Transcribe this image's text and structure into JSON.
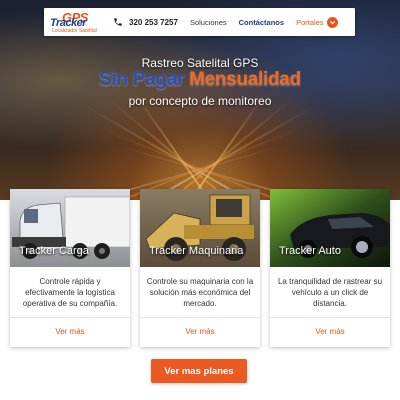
{
  "header": {
    "logo_text": "GPS Tracker",
    "logo_word": "Tracker",
    "logo_gps": "GPS",
    "logo_tagline": "Localizador Satelital",
    "phone_icon": "phone-icon",
    "phone_number": "320 253 7257",
    "nav": {
      "soluciones": "Soluciones",
      "contactanos": "Contáctanos",
      "portales": "Portales"
    }
  },
  "hero": {
    "line1": "Rastreo Satelital GPS",
    "line2_part1": "Sin Pagar",
    "line2_part2": "Mensualidad",
    "line3": "por concepto de monitoreo"
  },
  "cards": [
    {
      "title": "Tracker Carga",
      "text": "Controle rápida y efectivamente la logística operativa de su compañía.",
      "link": "Ver más"
    },
    {
      "title": "Tracker Maquinaria",
      "text": "Controle su maquinaria con la solución más económica del mercado.",
      "link": "Ver más"
    },
    {
      "title": "Tracker Auto",
      "text": "La tranquilidad de rastrear su vehículo a un click de distancia.",
      "link": "Ver más"
    }
  ],
  "cta": {
    "label": "Ver mas planes"
  },
  "colors": {
    "accent_orange": "#e4561c",
    "brand_blue": "#1d3f8a"
  }
}
